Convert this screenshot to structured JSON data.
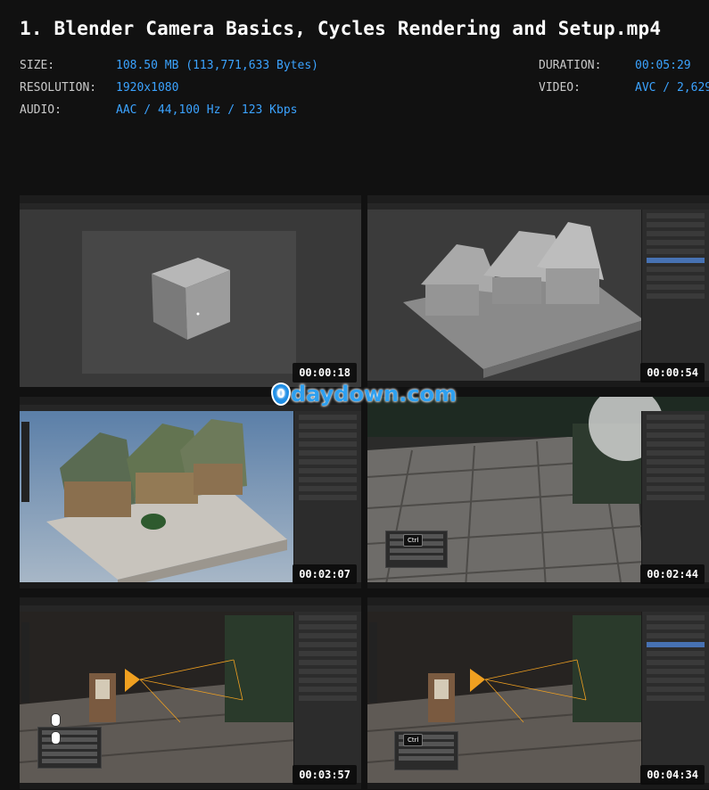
{
  "header": {
    "title": "1. Blender Camera Basics, Cycles Rendering and Setup.mp4"
  },
  "meta": {
    "size_label": "SIZE:",
    "size_value": "108.50 MB (113,771,633 Bytes)",
    "resolution_label": "RESOLUTION:",
    "resolution_value": "1920x1080",
    "audio_label": "AUDIO:",
    "audio_value": "AAC / 44,100 Hz / 123 Kbps",
    "duration_label": "DURATION:",
    "duration_value": "00:05:29",
    "video_label": "VIDEO:",
    "video_value": "AVC / 2,629"
  },
  "watermark": {
    "text": "daydown.com",
    "glyph": "0"
  },
  "thumbnails": [
    {
      "timestamp": "00:00:18",
      "scene": "default-cube"
    },
    {
      "timestamp": "00:00:54",
      "scene": "town-clay"
    },
    {
      "timestamp": "00:02:07",
      "scene": "town-textured"
    },
    {
      "timestamp": "00:02:44",
      "scene": "street-closeup",
      "key": "Ctrl"
    },
    {
      "timestamp": "00:03:57",
      "scene": "camera-view"
    },
    {
      "timestamp": "00:04:34",
      "scene": "camera-view-2",
      "key": "Ctrl"
    }
  ],
  "colors": {
    "background": "#111111",
    "value_text": "#3ba3ff",
    "label_text": "#c9c9c9",
    "camera_gizmo": "#f0a020"
  }
}
